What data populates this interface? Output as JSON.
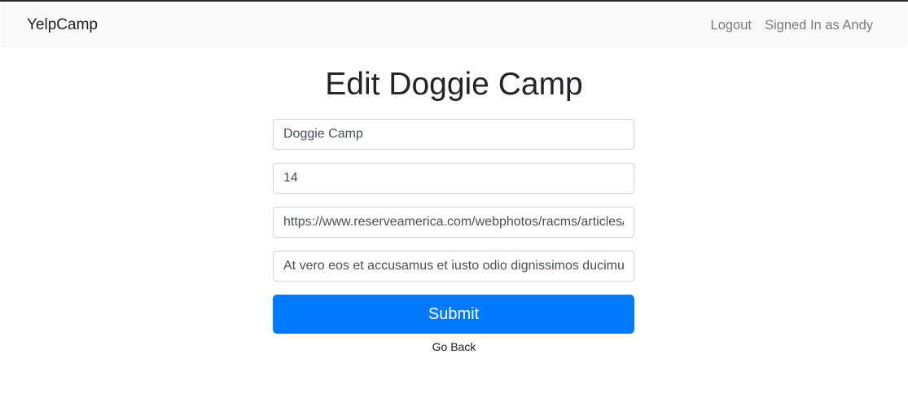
{
  "navbar": {
    "brand": "YelpCamp",
    "links": [
      {
        "label": "Logout"
      },
      {
        "label": "Signed In as Andy"
      }
    ]
  },
  "page": {
    "title": "Edit Doggie Camp"
  },
  "form": {
    "name_value": "Doggie Camp",
    "price_value": "14",
    "image_value": "https://www.reserveamerica.com/webphotos/racms/articles/",
    "description_value": "At vero eos et accusamus et iusto odio dignissimos ducimus qui blanditiis",
    "submit_label": "Submit"
  },
  "footer": {
    "go_back_label": "Go Back"
  },
  "colors": {
    "primary": "#007bff",
    "navbar_bg": "#f8f9fa",
    "nav_link": "#7a7a7a"
  }
}
